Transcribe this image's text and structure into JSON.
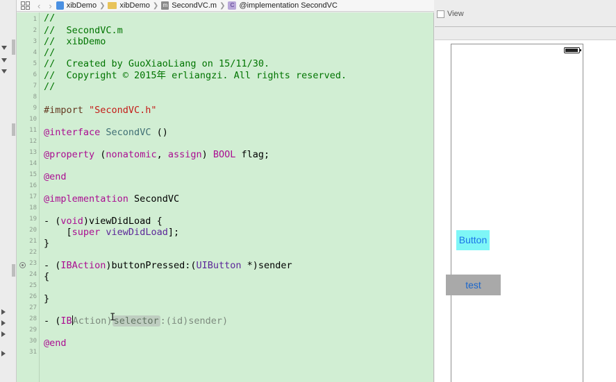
{
  "jumpbar": {
    "back": "‹",
    "forward": "›",
    "crumbs": [
      {
        "label": "xibDemo",
        "icon": "project-icon"
      },
      {
        "label": "xibDemo",
        "icon": "folder-icon"
      },
      {
        "label": "SecondVC.m",
        "icon": "m-file-icon",
        "badge": "m"
      },
      {
        "label": "@implementation SecondVC",
        "icon": "class-icon",
        "badge": "C"
      }
    ]
  },
  "editor": {
    "line_numbers": [
      "1",
      "2",
      "3",
      "4",
      "5",
      "6",
      "7",
      "8",
      "9",
      "10",
      "11",
      "12",
      "13",
      "14",
      "15",
      "16",
      "17",
      "18",
      "19",
      "20",
      "21",
      "22",
      "23",
      "24",
      "25",
      "26",
      "27",
      "28",
      "29",
      "30",
      "31"
    ],
    "code": {
      "l1": "//",
      "l2": "//  SecondVC.m",
      "l3": "//  xibDemo",
      "l4": "//",
      "l5": "//  Created by GuoXiaoLiang on 15/11/30.",
      "l6": "//  Copyright © 2015年 erliangzi. All rights reserved.",
      "l7": "//",
      "l9_import": "#import ",
      "l9_file": "\"SecondVC.h\"",
      "l11_kw": "@interface",
      "l11_name": "SecondVC",
      "l11_rest": " ()",
      "l13_kw": "@property",
      "l13_open": " (",
      "l13_attr1": "nonatomic",
      "l13_comma": ", ",
      "l13_attr2": "assign",
      "l13_close": ") ",
      "l13_type": "BOOL",
      "l13_rest": " flag;",
      "l15_kw": "@end",
      "l17_kw": "@implementation",
      "l17_name": " SecondVC",
      "l19_pre": "- (",
      "l19_type": "void",
      "l19_rest": ")viewDidLoad {",
      "l20_pre": "    [",
      "l20_super": "super",
      "l20_sp": " ",
      "l20_meth": "viewDidLoad",
      "l20_rest": "];",
      "l21": "}",
      "l23_pre": "- (",
      "l23_type": "IBAction",
      "l23_mid": ")buttonPressed:(",
      "l23_cls": "UIButton",
      "l23_rest": " *)sender",
      "l24": "{",
      "l26": "}",
      "l28_pre": "- (",
      "l28_typed": "IB",
      "l28_ghost": "Action)",
      "l28_token": "selector",
      "l28_rest": ":(id)sender)",
      "l30_kw": "@end"
    },
    "ibeam": "I"
  },
  "interface_builder": {
    "header_label": "View",
    "button_label": "Button",
    "test_label": "test"
  }
}
